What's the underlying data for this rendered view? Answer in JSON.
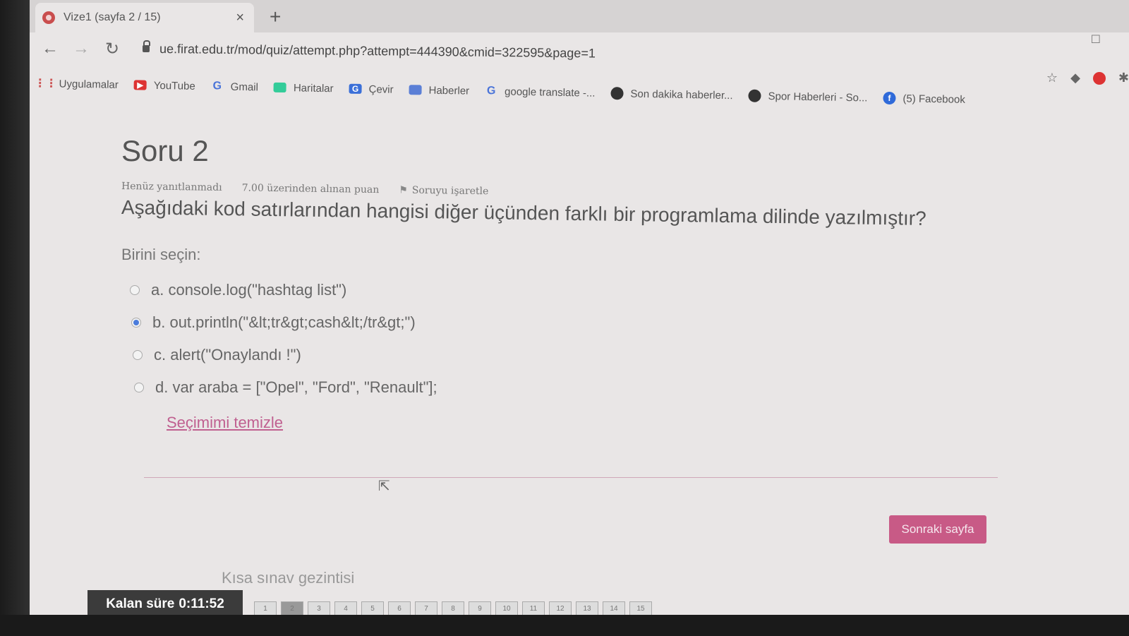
{
  "browser": {
    "tab_title": "Vize1 (sayfa 2 / 15)",
    "tab_close": "×",
    "new_tab": "+",
    "url": "ue.firat.edu.tr/mod/quiz/attempt.php?attempt=444390&cmid=322595&page=1",
    "bookmarks": [
      {
        "label": "Uygulamalar",
        "icon": "apps-icon"
      },
      {
        "label": "YouTube",
        "icon": "youtube-icon"
      },
      {
        "label": "Gmail",
        "icon": "google-icon"
      },
      {
        "label": "Haritalar",
        "icon": "maps-icon"
      },
      {
        "label": "Çevir",
        "icon": "translate-icon"
      },
      {
        "label": "Haberler",
        "icon": "news-icon"
      },
      {
        "label": "google translate -...",
        "icon": "google-icon"
      },
      {
        "label": "Son dakika haberler...",
        "icon": "site-icon"
      },
      {
        "label": "Spor Haberleri - So...",
        "icon": "site-icon"
      },
      {
        "label": "(5) Facebook",
        "icon": "facebook-icon"
      }
    ]
  },
  "question": {
    "title": "Soru 2",
    "status": "Henüz yanıtlanmadı",
    "points": "7.00 üzerinden alınan puan",
    "flag_label": "Soruyu işaretle",
    "text": "Aşağıdaki kod satırlarından hangisi diğer üçünden farklı bir programlama dilinde yazılmıştır?",
    "prompt": "Birini seçin:",
    "options": [
      {
        "label": "a. console.log(\"hashtag list\")",
        "selected": false
      },
      {
        "label": "b. out.println(\"&lt;tr&gt;cash&lt;/tr&gt;\")",
        "selected": true
      },
      {
        "label": "c. alert(\"Onaylandı !\")",
        "selected": false
      },
      {
        "label": "d. var araba = [\"Opel\", \"Ford\", \"Renault\"];",
        "selected": false
      }
    ],
    "clear_label": "Seçimimi temizle"
  },
  "footer": {
    "next_label": "Sonraki sayfa",
    "nav_heading": "Kısa sınav gezintisi",
    "timer_label": "Kalan süre",
    "timer_value": "0:11:52",
    "question_numbers": [
      "1",
      "2",
      "3",
      "4",
      "5",
      "6",
      "7",
      "8",
      "9",
      "10",
      "11",
      "12",
      "13",
      "14",
      "15"
    ],
    "current_page": "2"
  }
}
